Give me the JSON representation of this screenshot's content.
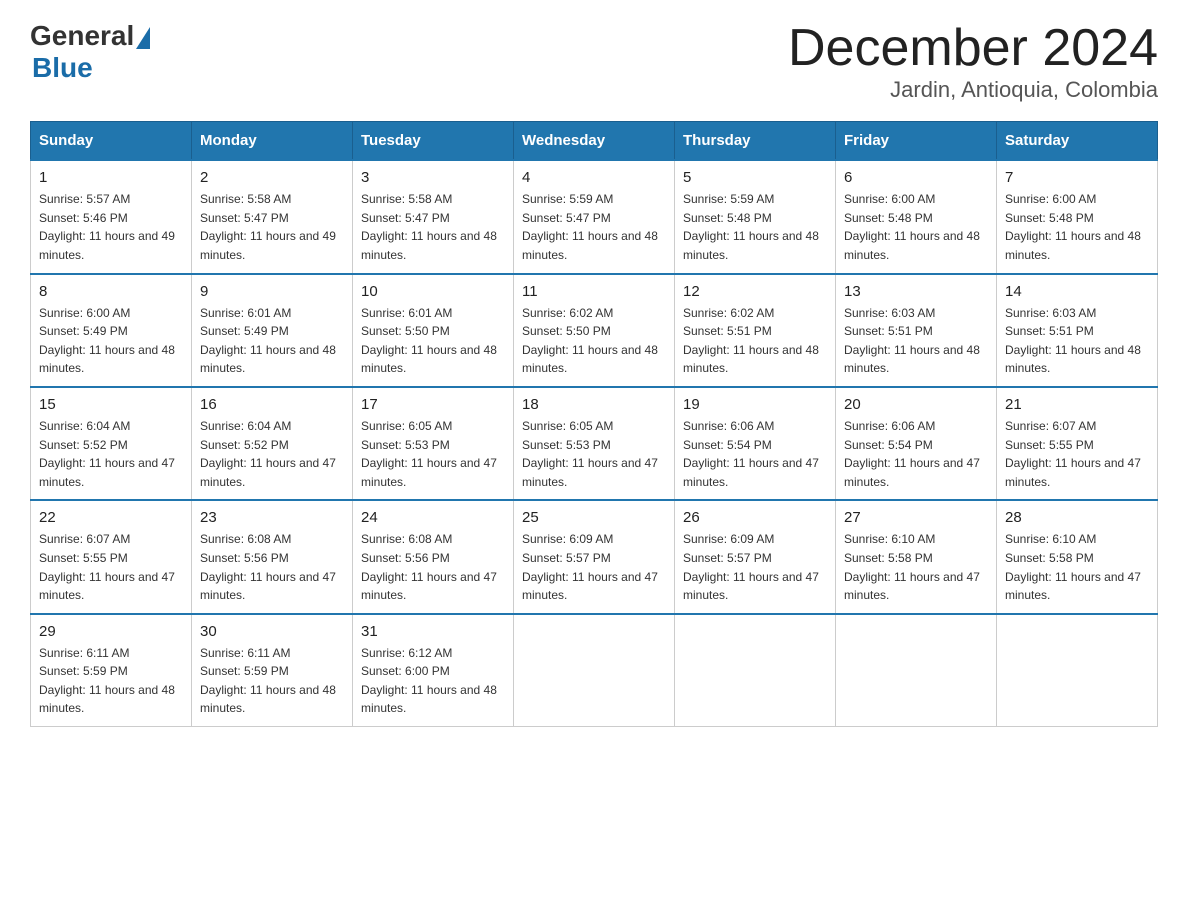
{
  "header": {
    "logo_general": "General",
    "logo_blue": "Blue",
    "month_title": "December 2024",
    "location": "Jardin, Antioquia, Colombia"
  },
  "weekdays": [
    "Sunday",
    "Monday",
    "Tuesday",
    "Wednesday",
    "Thursday",
    "Friday",
    "Saturday"
  ],
  "weeks": [
    [
      {
        "day": "1",
        "sunrise": "5:57 AM",
        "sunset": "5:46 PM",
        "daylight": "11 hours and 49 minutes."
      },
      {
        "day": "2",
        "sunrise": "5:58 AM",
        "sunset": "5:47 PM",
        "daylight": "11 hours and 49 minutes."
      },
      {
        "day": "3",
        "sunrise": "5:58 AM",
        "sunset": "5:47 PM",
        "daylight": "11 hours and 48 minutes."
      },
      {
        "day": "4",
        "sunrise": "5:59 AM",
        "sunset": "5:47 PM",
        "daylight": "11 hours and 48 minutes."
      },
      {
        "day": "5",
        "sunrise": "5:59 AM",
        "sunset": "5:48 PM",
        "daylight": "11 hours and 48 minutes."
      },
      {
        "day": "6",
        "sunrise": "6:00 AM",
        "sunset": "5:48 PM",
        "daylight": "11 hours and 48 minutes."
      },
      {
        "day": "7",
        "sunrise": "6:00 AM",
        "sunset": "5:48 PM",
        "daylight": "11 hours and 48 minutes."
      }
    ],
    [
      {
        "day": "8",
        "sunrise": "6:00 AM",
        "sunset": "5:49 PM",
        "daylight": "11 hours and 48 minutes."
      },
      {
        "day": "9",
        "sunrise": "6:01 AM",
        "sunset": "5:49 PM",
        "daylight": "11 hours and 48 minutes."
      },
      {
        "day": "10",
        "sunrise": "6:01 AM",
        "sunset": "5:50 PM",
        "daylight": "11 hours and 48 minutes."
      },
      {
        "day": "11",
        "sunrise": "6:02 AM",
        "sunset": "5:50 PM",
        "daylight": "11 hours and 48 minutes."
      },
      {
        "day": "12",
        "sunrise": "6:02 AM",
        "sunset": "5:51 PM",
        "daylight": "11 hours and 48 minutes."
      },
      {
        "day": "13",
        "sunrise": "6:03 AM",
        "sunset": "5:51 PM",
        "daylight": "11 hours and 48 minutes."
      },
      {
        "day": "14",
        "sunrise": "6:03 AM",
        "sunset": "5:51 PM",
        "daylight": "11 hours and 48 minutes."
      }
    ],
    [
      {
        "day": "15",
        "sunrise": "6:04 AM",
        "sunset": "5:52 PM",
        "daylight": "11 hours and 47 minutes."
      },
      {
        "day": "16",
        "sunrise": "6:04 AM",
        "sunset": "5:52 PM",
        "daylight": "11 hours and 47 minutes."
      },
      {
        "day": "17",
        "sunrise": "6:05 AM",
        "sunset": "5:53 PM",
        "daylight": "11 hours and 47 minutes."
      },
      {
        "day": "18",
        "sunrise": "6:05 AM",
        "sunset": "5:53 PM",
        "daylight": "11 hours and 47 minutes."
      },
      {
        "day": "19",
        "sunrise": "6:06 AM",
        "sunset": "5:54 PM",
        "daylight": "11 hours and 47 minutes."
      },
      {
        "day": "20",
        "sunrise": "6:06 AM",
        "sunset": "5:54 PM",
        "daylight": "11 hours and 47 minutes."
      },
      {
        "day": "21",
        "sunrise": "6:07 AM",
        "sunset": "5:55 PM",
        "daylight": "11 hours and 47 minutes."
      }
    ],
    [
      {
        "day": "22",
        "sunrise": "6:07 AM",
        "sunset": "5:55 PM",
        "daylight": "11 hours and 47 minutes."
      },
      {
        "day": "23",
        "sunrise": "6:08 AM",
        "sunset": "5:56 PM",
        "daylight": "11 hours and 47 minutes."
      },
      {
        "day": "24",
        "sunrise": "6:08 AM",
        "sunset": "5:56 PM",
        "daylight": "11 hours and 47 minutes."
      },
      {
        "day": "25",
        "sunrise": "6:09 AM",
        "sunset": "5:57 PM",
        "daylight": "11 hours and 47 minutes."
      },
      {
        "day": "26",
        "sunrise": "6:09 AM",
        "sunset": "5:57 PM",
        "daylight": "11 hours and 47 minutes."
      },
      {
        "day": "27",
        "sunrise": "6:10 AM",
        "sunset": "5:58 PM",
        "daylight": "11 hours and 47 minutes."
      },
      {
        "day": "28",
        "sunrise": "6:10 AM",
        "sunset": "5:58 PM",
        "daylight": "11 hours and 47 minutes."
      }
    ],
    [
      {
        "day": "29",
        "sunrise": "6:11 AM",
        "sunset": "5:59 PM",
        "daylight": "11 hours and 48 minutes."
      },
      {
        "day": "30",
        "sunrise": "6:11 AM",
        "sunset": "5:59 PM",
        "daylight": "11 hours and 48 minutes."
      },
      {
        "day": "31",
        "sunrise": "6:12 AM",
        "sunset": "6:00 PM",
        "daylight": "11 hours and 48 minutes."
      },
      null,
      null,
      null,
      null
    ]
  ]
}
